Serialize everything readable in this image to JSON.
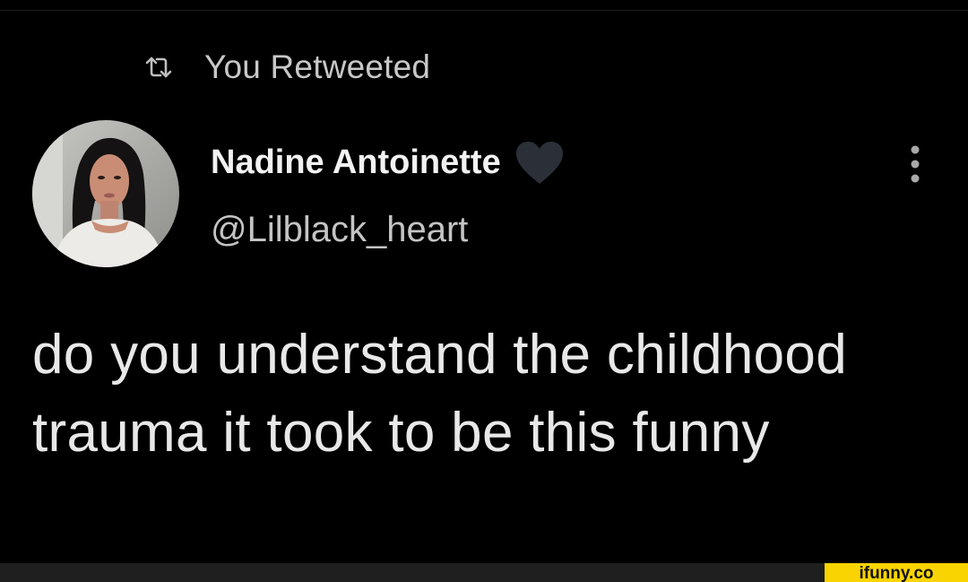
{
  "retweet": {
    "label": "You Retweeted",
    "icon": "retweet-icon"
  },
  "author": {
    "display_name": "Nadine Antoinette",
    "handle": "@Lilblack_heart",
    "name_emoji": "black-heart-icon",
    "avatar": "avatar-photo"
  },
  "tweet": {
    "text": "do you understand the childhood trauma it took to be this funny"
  },
  "menu": {
    "icon": "vertical-ellipsis-icon"
  },
  "watermark": {
    "text": "ifunny.co",
    "color": "#f9d400"
  },
  "colors": {
    "background": "#000000",
    "primary_text": "#e8e8e8",
    "secondary_text": "#c4c4c4",
    "heart": "#2b3038"
  }
}
